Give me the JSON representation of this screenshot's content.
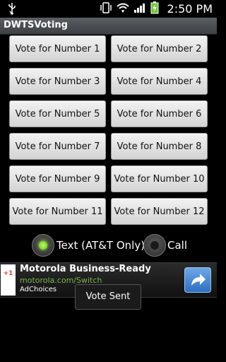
{
  "status_bar": {
    "time": "2:50 PM",
    "icons": [
      "usb-icon",
      "vibrate-icon",
      "wifi-icon",
      "signal-icon",
      "battery-charging-icon"
    ]
  },
  "app": {
    "title": "DWTSVoting"
  },
  "vote_buttons": [
    "Vote for Number 1",
    "Vote for Number 2",
    "Vote for Number 3",
    "Vote for Number 4",
    "Vote for Number 5",
    "Vote for Number 6",
    "Vote for Number 7",
    "Vote for Number 8",
    "Vote for Number 9",
    "Vote for Number 10",
    "Vote for Number 11",
    "Vote for Number 12"
  ],
  "vote_method": {
    "options": [
      {
        "label": "Text (AT&T Only)",
        "selected": true
      },
      {
        "label": "Call",
        "selected": false
      }
    ]
  },
  "ad": {
    "badge": "+1",
    "title": "Motorola Business-Ready",
    "url": "motorola.com/Switch",
    "choices": "AdChoices"
  },
  "toast": {
    "message": "Vote Sent"
  },
  "colors": {
    "selected_radio": "#7ddc1f",
    "unselected_radio": "#222222",
    "ad_url": "#7ab648"
  }
}
